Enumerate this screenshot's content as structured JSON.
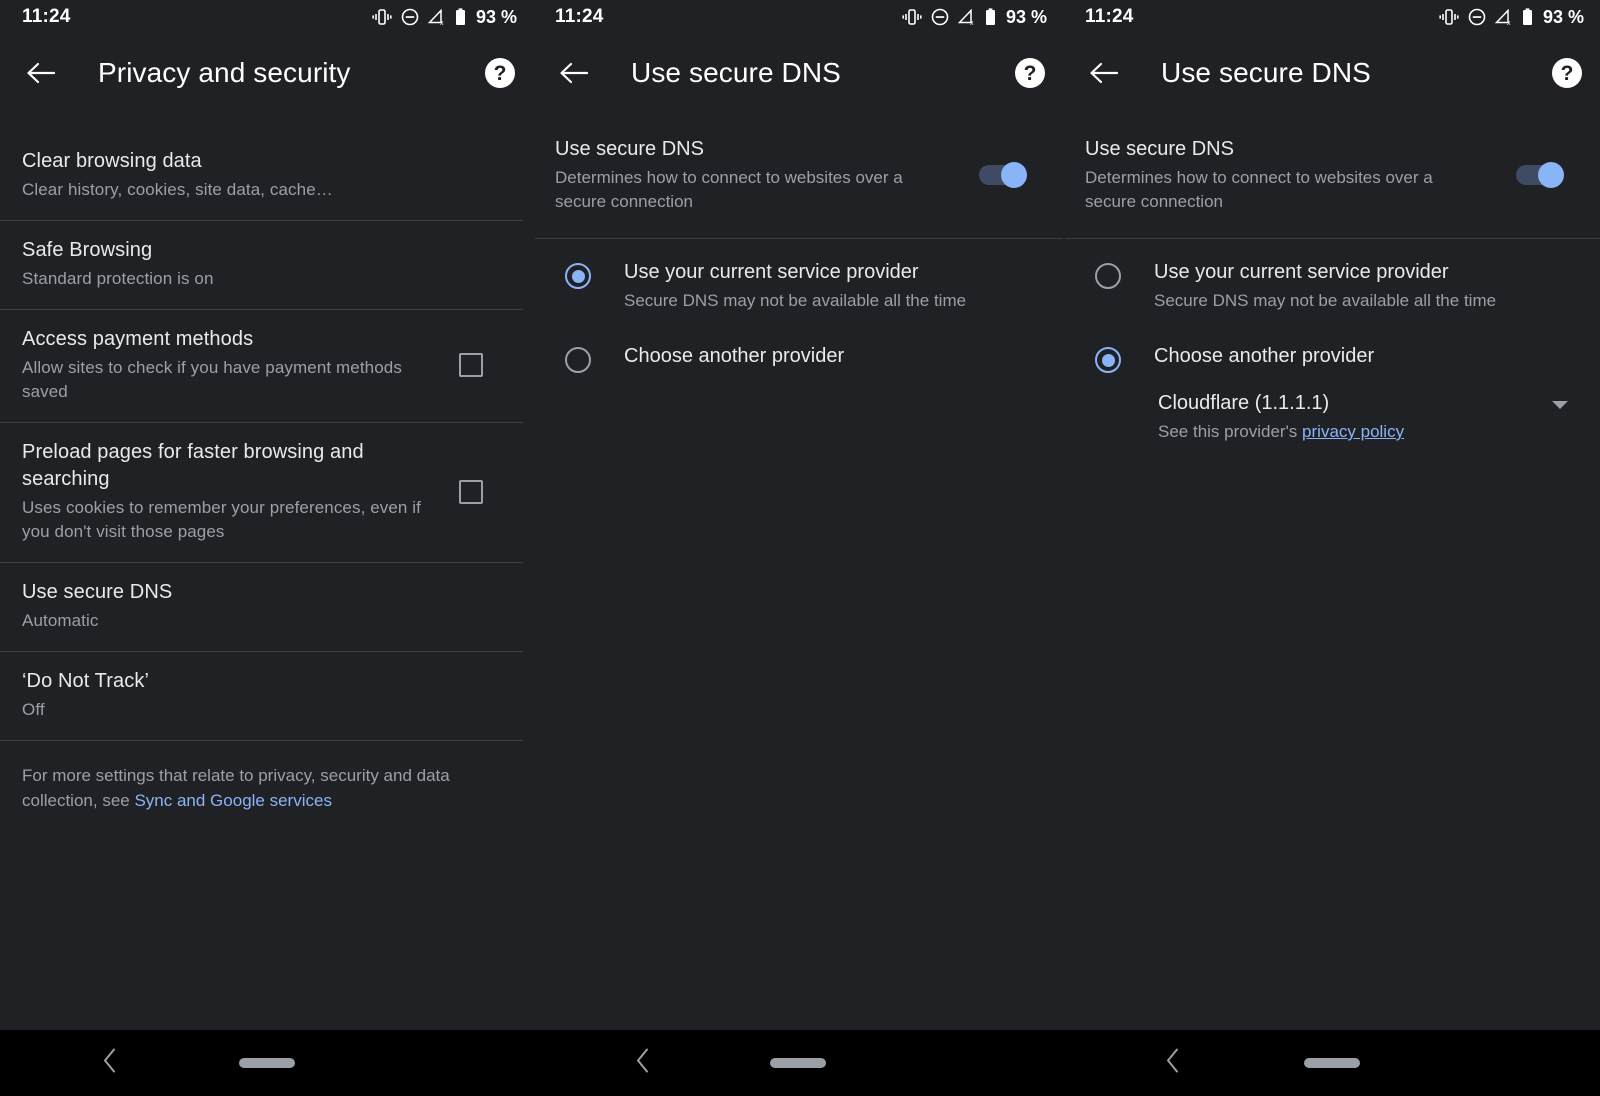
{
  "status": {
    "time": "11:24",
    "battery": "93 %",
    "icons": [
      "vibrate-icon",
      "do-not-disturb-icon",
      "no-signal-icon",
      "battery-icon"
    ]
  },
  "colors": {
    "background": "#202124",
    "text_primary": "#e8eaed",
    "text_secondary": "#9aa0a6",
    "accent": "#8ab4f8",
    "divider": "#3c4043",
    "navbar": "#000000"
  },
  "panel1": {
    "appbar": {
      "title": "Privacy and security",
      "back": "back-arrow-icon",
      "help": "?"
    },
    "items": [
      {
        "title": "Clear browsing data",
        "subtitle": "Clear history, cookies, site data, cache…",
        "control": "none"
      },
      {
        "title": "Safe Browsing",
        "subtitle": "Standard protection is on",
        "control": "none"
      },
      {
        "title": "Access payment methods",
        "subtitle": "Allow sites to check if you have payment methods saved",
        "control": "checkbox",
        "checked": false
      },
      {
        "title": "Preload pages for faster browsing and searching",
        "subtitle": "Uses cookies to remember your preferences, even if you don't visit those pages",
        "control": "checkbox",
        "checked": false
      },
      {
        "title": "Use secure DNS",
        "subtitle": "Automatic",
        "control": "none"
      },
      {
        "title": "‘Do Not Track’",
        "subtitle": "Off",
        "control": "none"
      }
    ],
    "footnote_text": "For more settings that relate to privacy, security and data collection, see ",
    "footnote_link": "Sync and Google services"
  },
  "panel2": {
    "appbar": {
      "title": "Use secure DNS",
      "back": "back-arrow-icon",
      "help": "?"
    },
    "toggle_row": {
      "title": "Use secure DNS",
      "subtitle": "Determines how to connect to websites over a secure connection",
      "toggle_on": true
    },
    "options": [
      {
        "title": "Use your current service provider",
        "subtitle": "Secure DNS may not be available all the time",
        "selected": true
      },
      {
        "title": "Choose another provider",
        "subtitle": "",
        "selected": false
      }
    ]
  },
  "panel3": {
    "appbar": {
      "title": "Use secure DNS",
      "back": "back-arrow-icon",
      "help": "?"
    },
    "toggle_row": {
      "title": "Use secure DNS",
      "subtitle": "Determines how to connect to websites over a secure connection",
      "toggle_on": true
    },
    "options": [
      {
        "title": "Use your current service provider",
        "subtitle": "Secure DNS may not be available all the time",
        "selected": false
      },
      {
        "title": "Choose another provider",
        "subtitle": "",
        "selected": true
      }
    ],
    "provider_spinner": {
      "value": "Cloudflare (1.1.1.1)",
      "note_prefix": "See this provider's ",
      "note_link": "privacy policy"
    }
  },
  "navbar": {
    "back": "nav-back-icon",
    "home": "nav-home-pill"
  }
}
